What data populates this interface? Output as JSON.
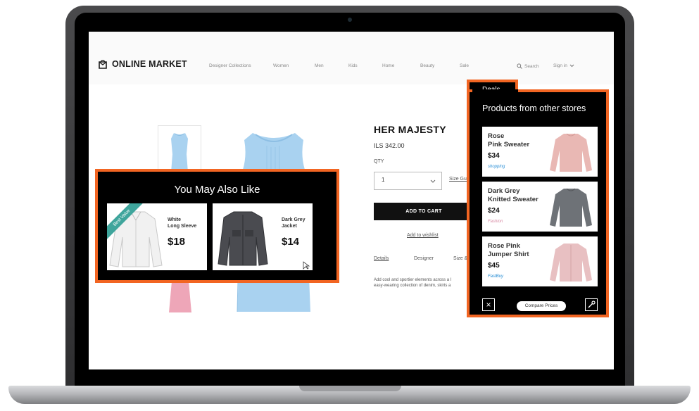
{
  "site": {
    "name": "ONLINE MARKET"
  },
  "nav": {
    "items": [
      "Designer Collections",
      "Women",
      "Men",
      "Kids",
      "Home",
      "Beauty",
      "Sale"
    ],
    "search_label": "Search",
    "signin_label": "Sign in"
  },
  "product": {
    "title": "HER MAJESTY",
    "price": "ILS 342.00",
    "qty_label": "QTY",
    "qty_value": "1",
    "size_guide": "Size Gui",
    "add_to_cart": "ADD TO CART",
    "wishlist": "Add to wishlist",
    "tabs": [
      "Details",
      "Designer",
      "Size &"
    ],
    "description_line1": "Add cool and sportier elements across a l",
    "description_line2": "easy-wearing collection of denim, skirts a"
  },
  "you_may_also_like": {
    "title": "You May Also Like",
    "items": [
      {
        "name": "White\nLong Sleeve",
        "price": "$18",
        "badge": "Best Value"
      },
      {
        "name": "Dark Grey\nJacket",
        "price": "$14"
      }
    ]
  },
  "deals": {
    "tab_label": "Deals",
    "title": "Products from other stores",
    "items": [
      {
        "name": "Rose\nPink Sweater",
        "price": "$34",
        "store": "shopping",
        "color": "#e9b8b4"
      },
      {
        "name": "Dark Grey\nKnitted Sweater",
        "price": "$24",
        "store": "Fashion",
        "color": "#6e7277"
      },
      {
        "name": "Rose Pink\nJumper Shirt",
        "price": "$45",
        "store": "FastBuy",
        "color": "#e8c0c2"
      }
    ],
    "compare_label": "Compare Prices",
    "close_icon": "×"
  },
  "colors": {
    "accent": "#f26522",
    "ribbon": "#3fa59c",
    "dress": "#a9d2f0"
  }
}
